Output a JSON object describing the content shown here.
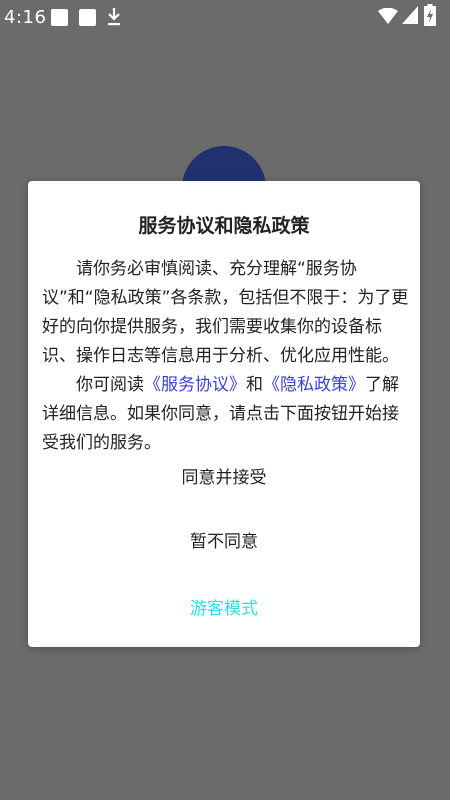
{
  "status_bar": {
    "time": "4:16"
  },
  "dialog": {
    "title": "服务协议和隐私政策",
    "paragraph1": "请你务必审慎阅读、充分理解“服务协议”和“隐私政策”各条款，包括但不限于：为了更好的向你提供服务，我们需要收集你的设备标识、操作日志等信息用于分析、优化应用性能。",
    "paragraph2_before": "你可阅读",
    "service_link": "《服务协议》",
    "paragraph2_middle": "和",
    "privacy_link": "《隐私政策》",
    "paragraph2_after": "了解详细信息。如果你同意，请点击下面按钮开始接受我们的服务。",
    "accept_label": "同意并接受",
    "decline_label": "暂不同意",
    "guest_label": "游客模式"
  },
  "colors": {
    "overlay": "#6b6b6b",
    "link": "#3a3fd6",
    "guest": "#2ee0e6"
  },
  "icons": [
    "download-icon",
    "wifi-icon",
    "cell-signal-icon",
    "battery-charging-icon"
  ]
}
